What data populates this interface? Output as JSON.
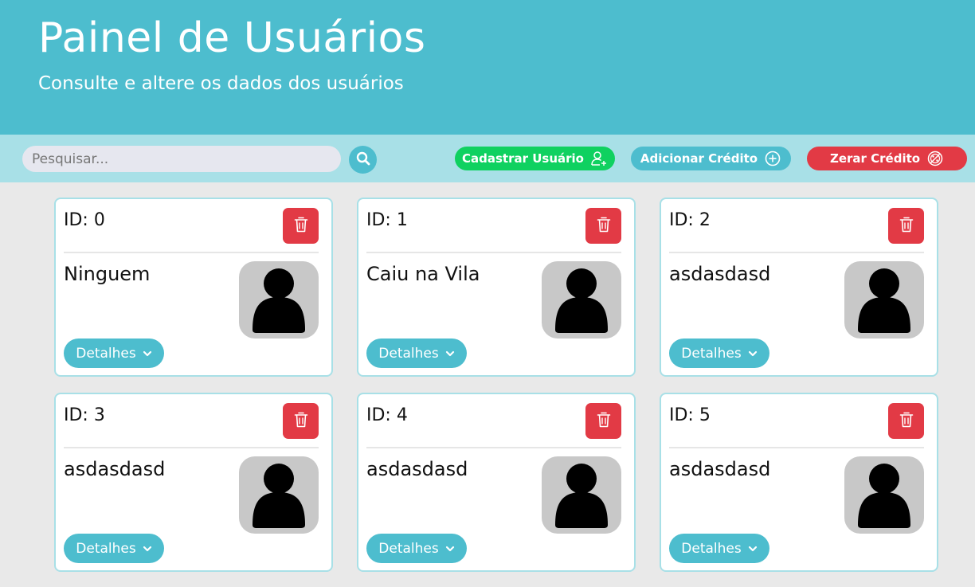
{
  "header": {
    "title": "Painel de Usuários",
    "subtitle": "Consulte e altere os dados dos usuários"
  },
  "toolbar": {
    "search_placeholder": "Pesquisar...",
    "register_label": "Cadastrar Usuário",
    "add_credit_label": "Adicionar Crédito",
    "reset_credit_label": "Zerar Crédito"
  },
  "colors": {
    "header_bg": "#4dbdce",
    "toolbar_bg": "#a8e0e7",
    "green": "#0fd160",
    "red": "#e23a45",
    "avatar_bg": "#c8c8c8"
  },
  "cards": [
    {
      "id": "ID: 0",
      "name": "Ninguem",
      "details_label": "Detalhes"
    },
    {
      "id": "ID: 1",
      "name": "Caiu na Vila",
      "details_label": "Detalhes"
    },
    {
      "id": "ID: 2",
      "name": "asdasdasd",
      "details_label": "Detalhes"
    },
    {
      "id": "ID: 3",
      "name": "asdasdasd",
      "details_label": "Detalhes"
    },
    {
      "id": "ID: 4",
      "name": "asdasdasd",
      "details_label": "Detalhes"
    },
    {
      "id": "ID: 5",
      "name": "asdasdasd",
      "details_label": "Detalhes"
    }
  ],
  "icons": {
    "search": "search-icon",
    "register": "user-plus-icon",
    "add_credit": "plus-circle-icon",
    "reset_credit": "percent-off-icon",
    "delete": "trash-icon",
    "avatar": "user-silhouette-icon",
    "details": "chevron-down-icon"
  }
}
